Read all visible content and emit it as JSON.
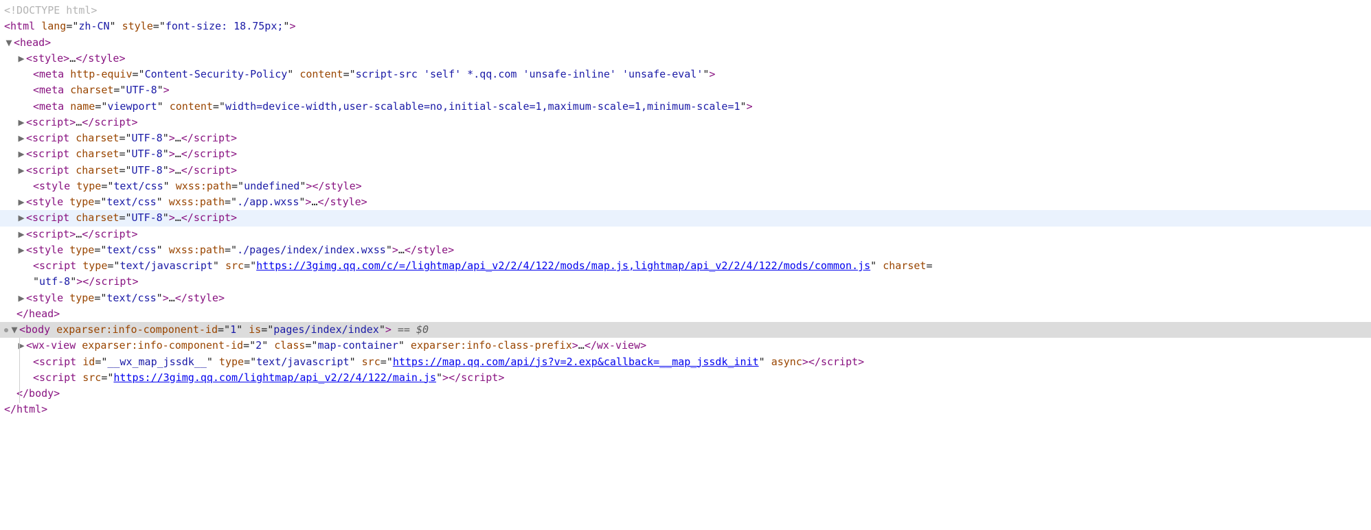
{
  "lines": {
    "doctype": "<!DOCTYPE html>",
    "html_open": {
      "raw": "<html lang=\"zh-CN\" style=\"font-size: 18.75px;\">",
      "lang": "zh-CN",
      "style": "font-size: 18.75px;"
    },
    "head_open": "<head>",
    "style1": {
      "open": "<style>",
      "mid": "…",
      "close": "</style>"
    },
    "meta_csp": {
      "attr": "http-equiv",
      "val1": "Content-Security-Policy",
      "attr2": "content",
      "val2": "script-src 'self' *.qq.com 'unsafe-inline' 'unsafe-eval'"
    },
    "meta_charset": {
      "attr": "charset",
      "val": "UTF-8"
    },
    "meta_viewport": {
      "attr": "name",
      "val1": "viewport",
      "attr2": "content",
      "val2": "width=device-width,user-scalable=no,initial-scale=1,maximum-scale=1,minimum-scale=1"
    },
    "scr1": {
      "open": "<script>",
      "mid": "…"
    },
    "scr2": {
      "charset": "UTF-8",
      "mid": "…"
    },
    "scr3": {
      "charset": "UTF-8",
      "mid": "…"
    },
    "scr4": {
      "charset": "UTF-8",
      "mid": "…"
    },
    "style_undef": {
      "type": "text/css",
      "path": "undefined"
    },
    "style_app": {
      "type": "text/css",
      "path": "./app.wxss",
      "mid": "…"
    },
    "scr5": {
      "charset": "UTF-8",
      "mid": "…"
    },
    "scr6": {
      "mid": "…"
    },
    "style_index": {
      "type": "text/css",
      "path": "./pages/index/index.wxss",
      "mid": "…"
    },
    "scr_map": {
      "type": "text/javascript",
      "src": "https://3gimg.qq.com/c/=/lightmap/api_v2/2/4/122/mods/map.js,lightmap/api_v2/2/4/122/mods/common.js",
      "charset": "utf-8"
    },
    "style_last": {
      "type": "text/css",
      "mid": "…"
    },
    "head_close": "</head>",
    "body_open": {
      "compid": "1",
      "is": "pages/index/index",
      "eq": " == $0"
    },
    "wxview": {
      "compid": "2",
      "class": "map-container",
      "prefix": "exparser:info-class-prefix",
      "mid": "…"
    },
    "scr_jssdk": {
      "id": "__wx_map_jssdk__",
      "type": "text/javascript",
      "src": "https://map.qq.com/api/js?v=2.exp&callback=__map_jssdk_init",
      "async": "async"
    },
    "scr_main": {
      "src": "https://3gimg.qq.com/lightmap/api_v2/2/4/122/main.js"
    },
    "body_close": "</body>",
    "html_close": "</html>"
  },
  "glyphs": {
    "right": "▶",
    "down": "▼"
  }
}
